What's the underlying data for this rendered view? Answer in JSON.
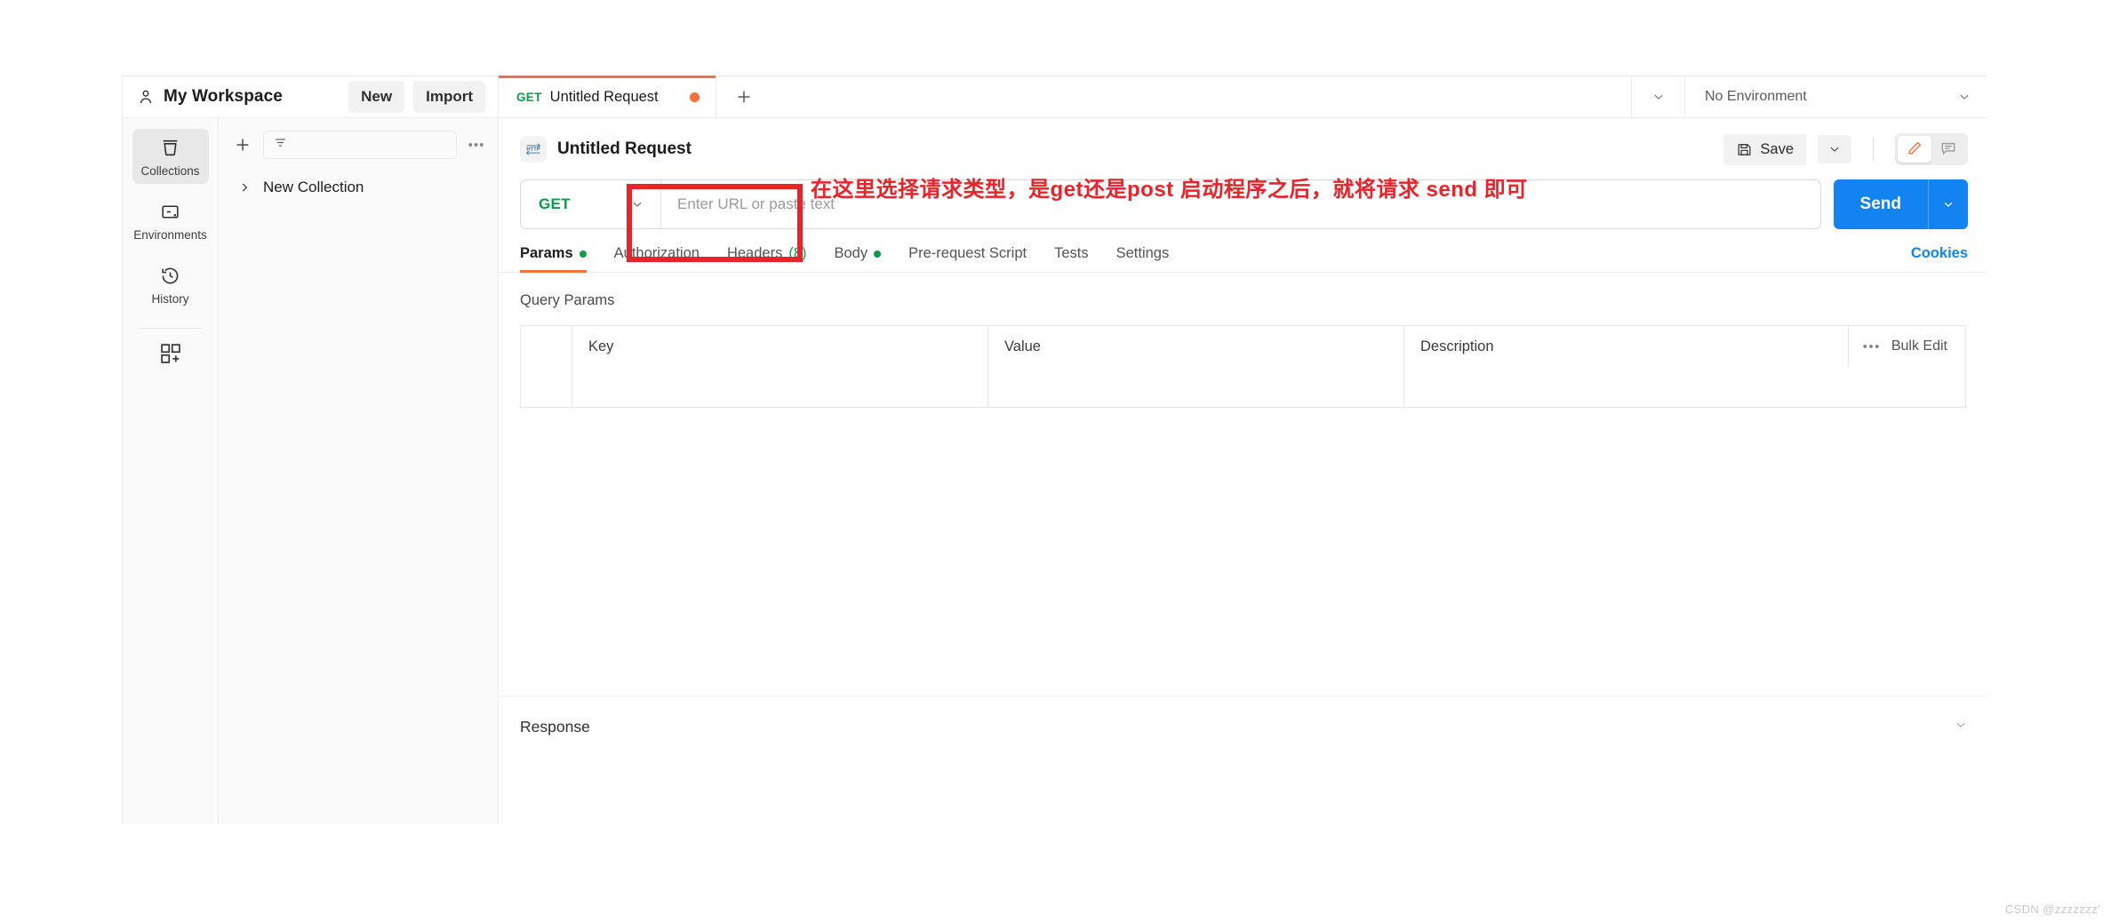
{
  "workspace": {
    "name": "My Workspace",
    "person_icon": "person-icon",
    "new_label": "New",
    "import_label": "Import"
  },
  "tabs_bar": {
    "request_tab": {
      "method": "GET",
      "title": "Untitled Request",
      "unsaved_dot": "unsaved-dot"
    },
    "new_tab_icon": "plus-icon",
    "tab_list_caret": "chevron-down-icon",
    "environment": {
      "value": "No Environment",
      "caret": "chevron-down-icon"
    }
  },
  "rail": {
    "items": [
      {
        "label": "Collections",
        "icon": "collections-icon",
        "active": true
      },
      {
        "label": "Environments",
        "icon": "environments-icon",
        "active": false
      },
      {
        "label": "History",
        "icon": "history-icon",
        "active": false
      }
    ],
    "add_icon": "add-panel-icon"
  },
  "collections_panel": {
    "create_icon": "plus-icon",
    "filter_icon": "filter-icon",
    "filter_placeholder": "",
    "more_icon": "ellipsis-icon",
    "tree": [
      {
        "name": "New Collection",
        "caret": "chevron-right-icon"
      }
    ]
  },
  "request": {
    "icon": "http-icon",
    "name": "Untitled Request",
    "save_label": "Save",
    "save_icon": "floppy-disk-icon",
    "save_caret": "chevron-down-icon",
    "edit_icon": "pencil-icon",
    "comment_icon": "comment-icon",
    "method": "GET",
    "method_caret": "chevron-down-icon",
    "url_value": "",
    "url_placeholder": "Enter URL or paste text",
    "send_label": "Send",
    "send_caret": "chevron-down-icon"
  },
  "request_tabs": [
    {
      "label": "Params",
      "dot": true,
      "active": true
    },
    {
      "label": "Authorization",
      "dot": false,
      "active": false
    },
    {
      "label": "Headers",
      "count": "(8)",
      "dot": false,
      "active": false
    },
    {
      "label": "Body",
      "dot": true,
      "active": false
    },
    {
      "label": "Pre-request Script",
      "dot": false,
      "active": false
    },
    {
      "label": "Tests",
      "dot": false,
      "active": false
    },
    {
      "label": "Settings",
      "dot": false,
      "active": false
    }
  ],
  "cookies_label": "Cookies",
  "query_params": {
    "title": "Query Params",
    "columns": [
      "Key",
      "Value",
      "Description"
    ],
    "bulk_edit_label": "Bulk Edit",
    "bulk_more_icon": "ellipsis-icon",
    "rows": [
      {
        "key": "",
        "value": "",
        "description": ""
      }
    ]
  },
  "response": {
    "title": "Response",
    "collapse_caret": "chevron-down-icon"
  },
  "annotations": {
    "box_label": "method-selector-highlight",
    "text": "在这里选择请求类型，是get还是post  启动程序之后，就将请求 send 即可",
    "color": "#e8232a"
  },
  "watermark": "CSDN @zzzzzzz'",
  "colors": {
    "accent_orange": "#f4703c",
    "method_green": "#0c9b4b",
    "send_blue": "#1283f0",
    "annotation_red": "#e8232a"
  }
}
